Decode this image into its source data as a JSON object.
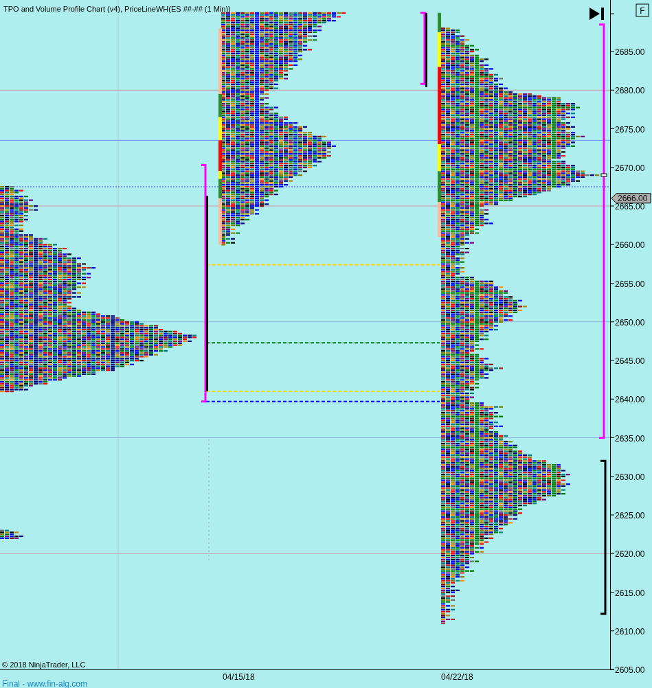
{
  "title": "TPO and Volume Profile Chart (v4), PriceLineWH(ES ##-## (1 Min))",
  "toolbar": {
    "flag_button": "F"
  },
  "copyright": "© 2018 NinjaTrader, LLC",
  "price_axis": {
    "labels": [
      "2685.00",
      "2680.00",
      "2675.00",
      "2670.00",
      "2665.00",
      "2660.00",
      "2655.00",
      "2650.00",
      "2645.00",
      "2640.00",
      "2635.00",
      "2630.00",
      "2625.00",
      "2620.00",
      "2615.00",
      "2610.00",
      "2605.00"
    ],
    "current_price": "2666.00"
  },
  "date_axis": [
    "04/15/18",
    "04/22/18"
  ],
  "footer_link": "Final - www.fin-alg.com"
}
